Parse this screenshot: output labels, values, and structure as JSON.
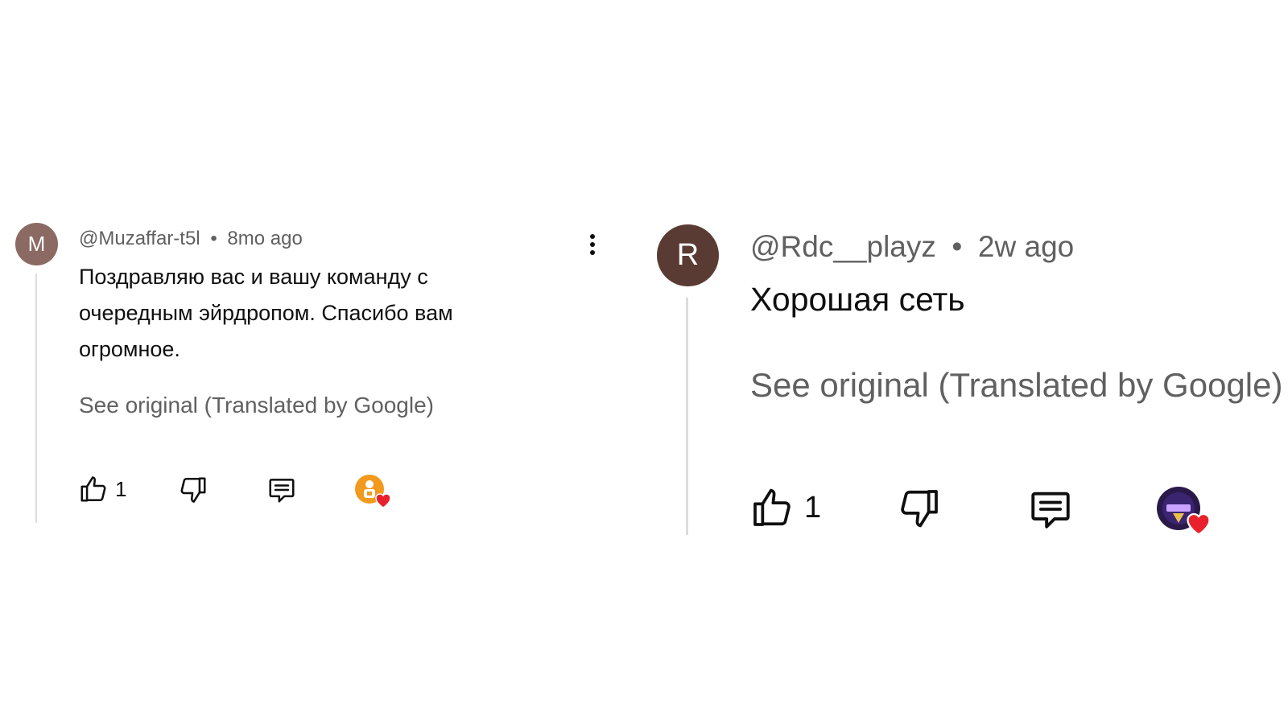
{
  "comments": [
    {
      "avatar_letter": "M",
      "avatar_color": "#8b6a63",
      "author": "@Muzaffar-t5l",
      "separator": "•",
      "time": "8mo ago",
      "text": "Поздравляю вас и вашу команду с очередным эйрдропом. Спасибо вам огромное.",
      "see_original": "See original (Translated by Google)",
      "like_count": "1",
      "creator_heart_icon": "creator-heart-avatar-icon"
    },
    {
      "avatar_letter": "R",
      "avatar_color": "#5a3b33",
      "author": "@Rdc__playz",
      "separator": "•",
      "time": "2w ago",
      "text": "Хорошая сеть",
      "see_original": "See original (Translated by Google)",
      "like_count": "1",
      "creator_heart_icon": "creator-heart-avatar-icon"
    }
  ],
  "colors": {
    "heart": "#e8212c",
    "text_primary": "#0f0f0f",
    "text_secondary": "#606060",
    "left_creator_avatar": "#f29a1d",
    "right_creator_avatar": "#2a1a4a"
  }
}
